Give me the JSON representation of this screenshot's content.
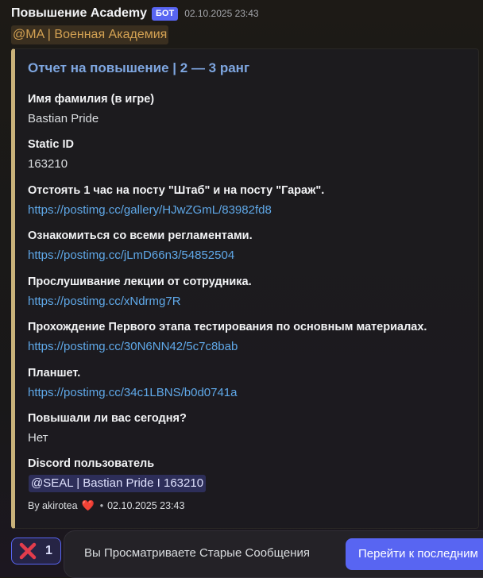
{
  "message": {
    "author": "Повышение Academy",
    "bot_tag": "БОТ",
    "timestamp": "02.10.2025 23:43",
    "role_mention": "@MA | Военная Академия"
  },
  "embed": {
    "accent_color": "#c9b27a",
    "title": "Отчет на повышение | 2 — 3 ранг",
    "fields": [
      {
        "name": "Имя фамилия (в игре)",
        "value": "Bastian Pride"
      },
      {
        "name": "Static ID",
        "value": "163210"
      },
      {
        "name": "Отстоять 1 час на посту \"Штаб\" и на посту \"Гараж\".",
        "value": "https://postimg.cc/gallery/HJwZGmL/83982fd8"
      },
      {
        "name": "Ознакомиться со всеми регламентами.",
        "value": "https://postimg.cc/jLmD66n3/54852504"
      },
      {
        "name": "Прослушивание лекции от сотрудника.",
        "value": "https://postimg.cc/xNdrmg7R"
      },
      {
        "name": "Прохождение Первого этапа тестирования по основным материалах.",
        "value": "https://postimg.cc/30N6NN42/5c7c8bab"
      },
      {
        "name": "Планшет.",
        "value": "https://postimg.cc/34c1LBNS/b0d0741a"
      },
      {
        "name": "Повышали ли вас сегодня?",
        "value": "Нет"
      },
      {
        "name": "Discord пользователь",
        "value": "@SEAL | Bastian Pride I 163210"
      }
    ],
    "footer": {
      "by": "By akirotea",
      "icon": "heart-icon",
      "separator": "•",
      "timestamp": "02.10.2025 23:43"
    }
  },
  "reaction": {
    "icon": "cross-mark-icon",
    "count": "1"
  },
  "jump_bar": {
    "text": "Вы Просматриваете Старые Сообщения",
    "button_label": "Перейти к последним"
  }
}
